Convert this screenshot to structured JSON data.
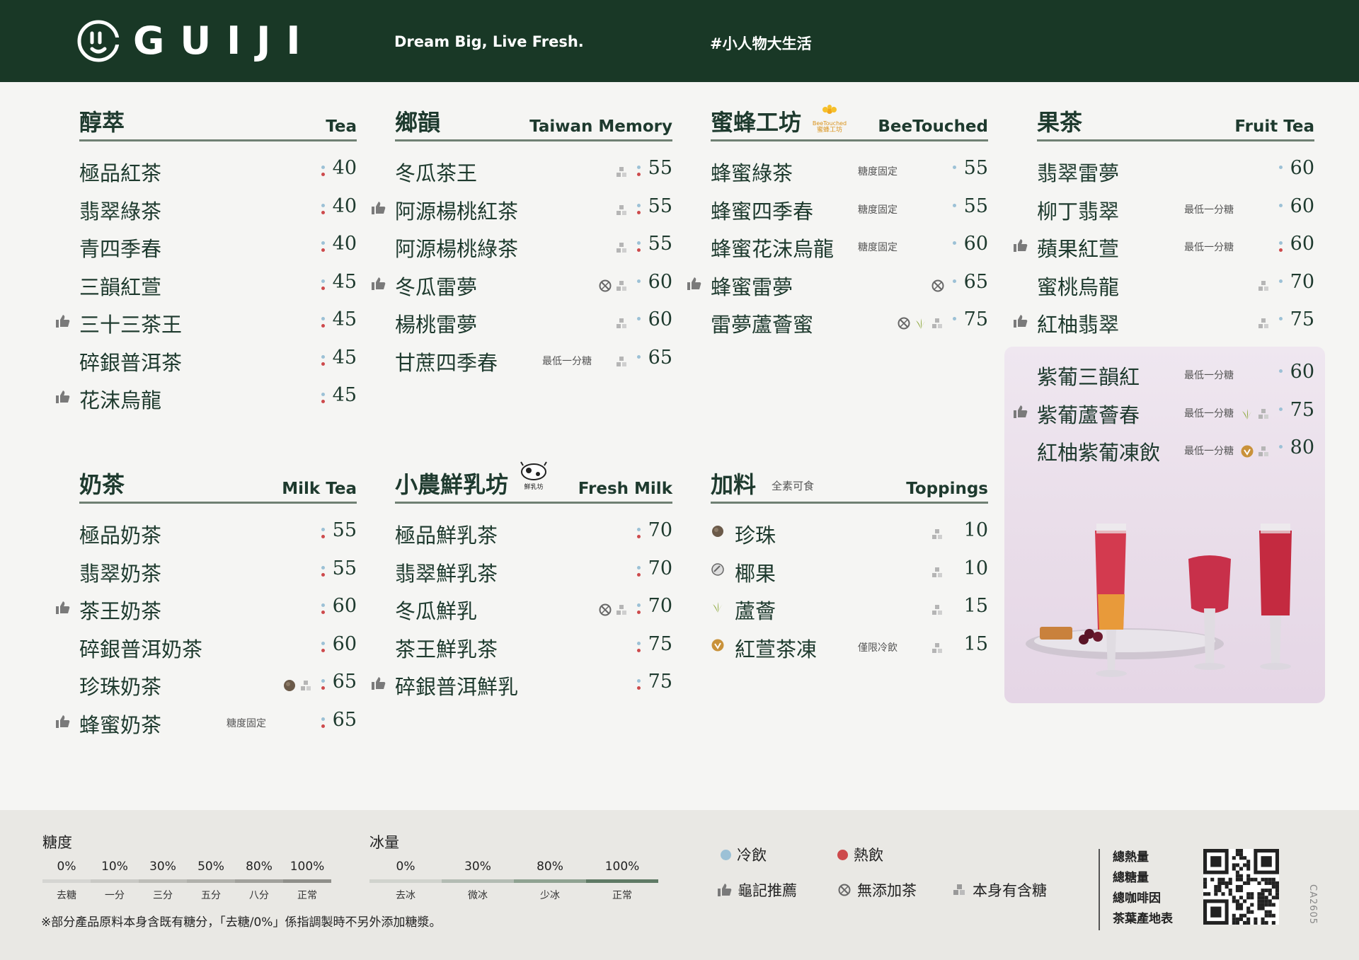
{
  "header": {
    "brand": "GUIJI",
    "tagline": "Dream Big, Live Fresh.",
    "hashtag": "#小人物大生活",
    "background": "#193826"
  },
  "colors": {
    "cold": "#9cc1d6",
    "hot": "#cd4a4c",
    "accent_green": "#6f8073"
  },
  "sections": {
    "tea": {
      "title": "醇萃",
      "en": "Tea",
      "items": [
        {
          "name": "極品紅茶",
          "price": "40",
          "hot": true,
          "cold": true
        },
        {
          "name": "翡翠綠茶",
          "price": "40",
          "hot": true,
          "cold": true
        },
        {
          "name": "青四季春",
          "price": "40",
          "hot": true,
          "cold": true
        },
        {
          "name": "三韻紅萱",
          "price": "45",
          "hot": true,
          "cold": true
        },
        {
          "name": "三十三茶王",
          "price": "45",
          "hot": true,
          "cold": true,
          "recommended": true
        },
        {
          "name": "碎銀普洱茶",
          "price": "45",
          "hot": true,
          "cold": true
        },
        {
          "name": "花沫烏龍",
          "price": "45",
          "hot": true,
          "cold": true,
          "recommended": true
        }
      ]
    },
    "taiwan": {
      "title": "鄉韻",
      "en": "Taiwan Memory",
      "items": [
        {
          "name": "冬瓜茶王",
          "price": "55",
          "hot": true,
          "cold": true,
          "icons": [
            "sugar"
          ]
        },
        {
          "name": "阿源楊桃紅茶",
          "price": "55",
          "hot": true,
          "cold": true,
          "icons": [
            "sugar"
          ],
          "recommended": true
        },
        {
          "name": "阿源楊桃綠茶",
          "price": "55",
          "hot": true,
          "cold": true,
          "icons": [
            "sugar"
          ]
        },
        {
          "name": "冬瓜雷夢",
          "price": "60",
          "cold": true,
          "icons": [
            "no-tea",
            "sugar"
          ],
          "recommended": true
        },
        {
          "name": "楊桃雷夢",
          "price": "60",
          "cold": true,
          "icons": [
            "sugar"
          ]
        },
        {
          "name": "甘蔗四季春",
          "price": "65",
          "cold": true,
          "icons": [
            "sugar"
          ],
          "note": "最低一分糖"
        }
      ]
    },
    "bee": {
      "title": "蜜蜂工坊",
      "en": "BeeTouched",
      "badge_line1": "BeeTouched",
      "badge_line2": "蜜蜂工坊",
      "items": [
        {
          "name": "蜂蜜綠茶",
          "price": "55",
          "cold": true,
          "note": "糖度固定"
        },
        {
          "name": "蜂蜜四季春",
          "price": "55",
          "cold": true,
          "note": "糖度固定"
        },
        {
          "name": "蜂蜜花沫烏龍",
          "price": "60",
          "cold": true,
          "note": "糖度固定"
        },
        {
          "name": "蜂蜜雷夢",
          "price": "65",
          "cold": true,
          "icons": [
            "no-tea"
          ],
          "recommended": true
        },
        {
          "name": "雷夢蘆薈蜜",
          "price": "75",
          "cold": true,
          "icons": [
            "no-tea",
            "aloe",
            "sugar"
          ]
        }
      ]
    },
    "fruit": {
      "title": "果茶",
      "en": "Fruit Tea",
      "items": [
        {
          "name": "翡翠雷夢",
          "price": "60",
          "cold": true
        },
        {
          "name": "柳丁翡翠",
          "price": "60",
          "cold": true,
          "note": "最低一分糖"
        },
        {
          "name": "蘋果紅萱",
          "price": "60",
          "hot": true,
          "cold": true,
          "note": "最低一分糖",
          "recommended": true
        },
        {
          "name": "蜜桃烏龍",
          "price": "70",
          "cold": true,
          "icons": [
            "sugar"
          ]
        },
        {
          "name": "紅柚翡翠",
          "price": "75",
          "cold": true,
          "icons": [
            "sugar"
          ],
          "recommended": true
        }
      ]
    },
    "promo": {
      "items": [
        {
          "name": "紫葡三韻紅",
          "price": "60",
          "cold": true,
          "note": "最低一分糖"
        },
        {
          "name": "紫葡蘆薈春",
          "price": "75",
          "cold": true,
          "note": "最低一分糖",
          "icons": [
            "aloe",
            "sugar"
          ],
          "recommended": true
        },
        {
          "name": "紅柚紫葡凍飲",
          "price": "80",
          "cold": true,
          "note": "最低一分糖",
          "icons": [
            "jelly",
            "sugar"
          ]
        }
      ]
    },
    "milktea": {
      "title": "奶茶",
      "en": "Milk Tea",
      "items": [
        {
          "name": "極品奶茶",
          "price": "55",
          "hot": true,
          "cold": true
        },
        {
          "name": "翡翠奶茶",
          "price": "55",
          "hot": true,
          "cold": true
        },
        {
          "name": "茶王奶茶",
          "price": "60",
          "hot": true,
          "cold": true,
          "recommended": true
        },
        {
          "name": "碎銀普洱奶茶",
          "price": "60",
          "hot": true,
          "cold": true
        },
        {
          "name": "珍珠奶茶",
          "price": "65",
          "hot": true,
          "cold": true,
          "icons": [
            "pearl",
            "sugar"
          ]
        },
        {
          "name": "蜂蜜奶茶",
          "price": "65",
          "hot": true,
          "cold": true,
          "note": "糖度固定",
          "recommended": true
        }
      ]
    },
    "freshmilk": {
      "title": "小農鮮乳坊",
      "en": "Fresh Milk",
      "badge": "鮮乳坊",
      "items": [
        {
          "name": "極品鮮乳茶",
          "price": "70",
          "hot": true,
          "cold": true
        },
        {
          "name": "翡翠鮮乳茶",
          "price": "70",
          "hot": true,
          "cold": true
        },
        {
          "name": "冬瓜鮮乳",
          "price": "70",
          "hot": true,
          "cold": true,
          "icons": [
            "no-tea",
            "sugar"
          ]
        },
        {
          "name": "茶王鮮乳茶",
          "price": "75",
          "hot": true,
          "cold": true
        },
        {
          "name": "碎銀普洱鮮乳",
          "price": "75",
          "hot": true,
          "cold": true,
          "recommended": true
        }
      ]
    },
    "toppings": {
      "title": "加料",
      "en": "Toppings",
      "note": "全素可食",
      "items": [
        {
          "name": "珍珠",
          "price": "10",
          "icon": "pearl",
          "icons": [
            "sugar"
          ]
        },
        {
          "name": "椰果",
          "price": "10",
          "icon": "coconut",
          "icons": [
            "sugar"
          ]
        },
        {
          "name": "蘆薈",
          "price": "15",
          "icon": "aloe",
          "icons": [
            "sugar"
          ]
        },
        {
          "name": "紅萱茶凍",
          "price": "15",
          "icon": "jelly",
          "icons": [
            "sugar"
          ],
          "note": "僅限冷飲"
        }
      ]
    }
  },
  "footer": {
    "sugar": {
      "label": "糖度",
      "levels": [
        {
          "pct": "0%",
          "sub": "去糖"
        },
        {
          "pct": "10%",
          "sub": "一分"
        },
        {
          "pct": "30%",
          "sub": "三分"
        },
        {
          "pct": "50%",
          "sub": "五分"
        },
        {
          "pct": "80%",
          "sub": "八分"
        },
        {
          "pct": "100%",
          "sub": "正常"
        }
      ]
    },
    "ice": {
      "label": "冰量",
      "levels": [
        {
          "pct": "0%",
          "sub": "去冰"
        },
        {
          "pct": "30%",
          "sub": "微冰"
        },
        {
          "pct": "80%",
          "sub": "少冰"
        },
        {
          "pct": "100%",
          "sub": "正常"
        }
      ]
    },
    "footnote": "※部分產品原料本身含既有糖分，「去糖/0%」係指調製時不另外添加糖漿。",
    "legend": {
      "cold": "冷飲",
      "hot": "熱飲",
      "recommend": "龜記推薦",
      "no_tea": "無添加茶",
      "sugar": "本身有含糖"
    },
    "qr_labels": [
      "總熱量",
      "總糖量",
      "總咖啡因",
      "茶葉產地表"
    ],
    "code": "CA2605"
  }
}
